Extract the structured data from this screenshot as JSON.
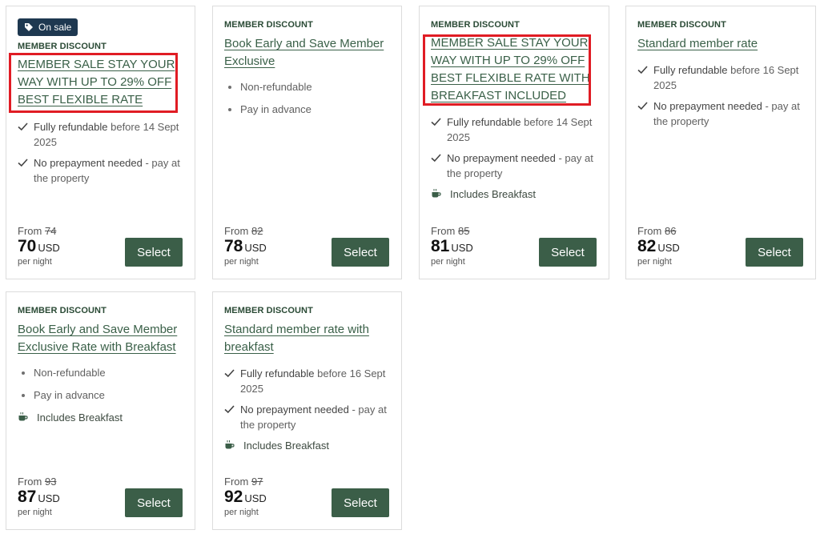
{
  "cards": [
    {
      "badge": "On sale",
      "label": "MEMBER DISCOUNT",
      "title": "MEMBER SALE STAY YOUR WAY WITH UP TO 29% OFF BEST FLEXIBLE RATE",
      "features": [
        {
          "strong": "Fully refundable",
          "rest": " before 14 Sept 2025"
        },
        {
          "strong": "No prepayment needed",
          "rest": " - pay at the property"
        }
      ],
      "from": "From",
      "old_price": "74",
      "price": "70",
      "currency": "USD",
      "per": "per night",
      "select": "Select"
    },
    {
      "label": "MEMBER DISCOUNT",
      "title": "Book Early and Save Member Exclusive",
      "features": [
        {
          "text": "Non-refundable"
        },
        {
          "text": "Pay in advance"
        }
      ],
      "from": "From",
      "old_price": "82",
      "price": "78",
      "currency": "USD",
      "per": "per night",
      "select": "Select"
    },
    {
      "label": "MEMBER DISCOUNT",
      "title": "MEMBER SALE STAY YOUR WAY WITH UP TO 29% OFF BEST FLEXIBLE RATE WITH BREAKFAST INCLUDED",
      "features": [
        {
          "strong": "Fully refundable",
          "rest": " before 14 Sept 2025"
        },
        {
          "strong": "No prepayment needed",
          "rest": " - pay at the property"
        },
        {
          "text": "Includes Breakfast"
        }
      ],
      "from": "From",
      "old_price": "85",
      "price": "81",
      "currency": "USD",
      "per": "per night",
      "select": "Select"
    },
    {
      "label": "MEMBER DISCOUNT",
      "title": "Standard member rate",
      "features": [
        {
          "strong": "Fully refundable",
          "rest": " before 16 Sept 2025"
        },
        {
          "strong": "No prepayment needed",
          "rest": " - pay at the property"
        }
      ],
      "from": "From",
      "old_price": "86",
      "price": "82",
      "currency": "USD",
      "per": "per night",
      "select": "Select"
    },
    {
      "label": "MEMBER DISCOUNT",
      "title": "Book Early and Save Member Exclusive Rate with Breakfast",
      "features": [
        {
          "text": "Non-refundable"
        },
        {
          "text": "Pay in advance"
        },
        {
          "text": "Includes Breakfast"
        }
      ],
      "from": "From",
      "old_price": "93",
      "price": "87",
      "currency": "USD",
      "per": "per night",
      "select": "Select"
    },
    {
      "label": "MEMBER DISCOUNT",
      "title": "Standard member rate with breakfast",
      "features": [
        {
          "strong": "Fully refundable",
          "rest": " before 16 Sept 2025"
        },
        {
          "strong": "No prepayment needed",
          "rest": " - pay at the property"
        },
        {
          "text": "Includes Breakfast"
        }
      ],
      "from": "From",
      "old_price": "97",
      "price": "92",
      "currency": "USD",
      "per": "per night",
      "select": "Select"
    }
  ],
  "colors": {
    "accent_green": "#3b5e48",
    "title_green": "#3a6048",
    "badge_navy": "#1e3850",
    "highlight_red": "#e01c24"
  },
  "icons": {
    "badge": "tag-icon",
    "refundable": "check-icon",
    "prepayment": "check-icon",
    "breakfast": "coffee-cup-icon",
    "policy": "bullet-icon"
  }
}
